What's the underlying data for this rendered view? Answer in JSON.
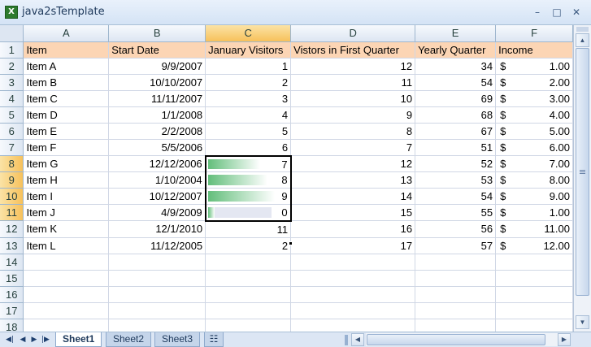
{
  "window": {
    "title": "java2sTemplate",
    "app_icon": "excel-icon"
  },
  "columns": [
    "A",
    "B",
    "C",
    "D",
    "E",
    "F"
  ],
  "header_row": {
    "A": "Item",
    "B": "Start Date",
    "C": "January Visitors",
    "D": "Vistors in First Quarter",
    "E": "Yearly Quarter",
    "F": "Income"
  },
  "rows": [
    {
      "num": "2",
      "item": "Item A",
      "date": "9/9/2007",
      "jan": "1",
      "q1": "12",
      "yearly": "34",
      "cur": "$",
      "income": "1.00"
    },
    {
      "num": "3",
      "item": "Item B",
      "date": "10/10/2007",
      "jan": "2",
      "q1": "11",
      "yearly": "54",
      "cur": "$",
      "income": "2.00"
    },
    {
      "num": "4",
      "item": "Item C",
      "date": "11/11/2007",
      "jan": "3",
      "q1": "10",
      "yearly": "69",
      "cur": "$",
      "income": "3.00"
    },
    {
      "num": "5",
      "item": "Item D",
      "date": "1/1/2008",
      "jan": "4",
      "q1": "9",
      "yearly": "68",
      "cur": "$",
      "income": "4.00"
    },
    {
      "num": "6",
      "item": "Item E",
      "date": "2/2/2008",
      "jan": "5",
      "q1": "8",
      "yearly": "67",
      "cur": "$",
      "income": "5.00"
    },
    {
      "num": "7",
      "item": "Item F",
      "date": "5/5/2006",
      "jan": "6",
      "q1": "7",
      "yearly": "51",
      "cur": "$",
      "income": "6.00"
    },
    {
      "num": "8",
      "item": "Item G",
      "date": "12/12/2006",
      "jan": "7",
      "q1": "12",
      "yearly": "52",
      "cur": "$",
      "income": "7.00"
    },
    {
      "num": "9",
      "item": "Item H",
      "date": "1/10/2004",
      "jan": "8",
      "q1": "13",
      "yearly": "53",
      "cur": "$",
      "income": "8.00"
    },
    {
      "num": "10",
      "item": "Item I",
      "date": "10/12/2007",
      "jan": "9",
      "q1": "14",
      "yearly": "54",
      "cur": "$",
      "income": "9.00"
    },
    {
      "num": "11",
      "item": "Item J",
      "date": "4/9/2009",
      "jan": "0",
      "q1": "15",
      "yearly": "55",
      "cur": "$",
      "income": "1.00"
    },
    {
      "num": "12",
      "item": "Item K",
      "date": "12/1/2010",
      "jan": "11",
      "q1": "16",
      "yearly": "56",
      "cur": "$",
      "income": "11.00"
    },
    {
      "num": "13",
      "item": "Item L",
      "date": "11/12/2005",
      "jan": "2",
      "q1": "17",
      "yearly": "57",
      "cur": "$",
      "income": "12.00"
    }
  ],
  "empty_rows": [
    "14",
    "15",
    "16",
    "17",
    "18"
  ],
  "data_bars": {
    "color_start": "#63be7b",
    "color_end": "#ffffff",
    "selected_rows": [
      "8",
      "9",
      "10",
      "11"
    ],
    "min": 0,
    "max": 9
  },
  "sheet_tabs": [
    "Sheet1",
    "Sheet2",
    "Sheet3"
  ],
  "active_tab": "Sheet1",
  "colors": {
    "header_fill": "#fcd5b4",
    "selection_header": "#f7c15b",
    "grid_line": "#d0d7e5"
  }
}
